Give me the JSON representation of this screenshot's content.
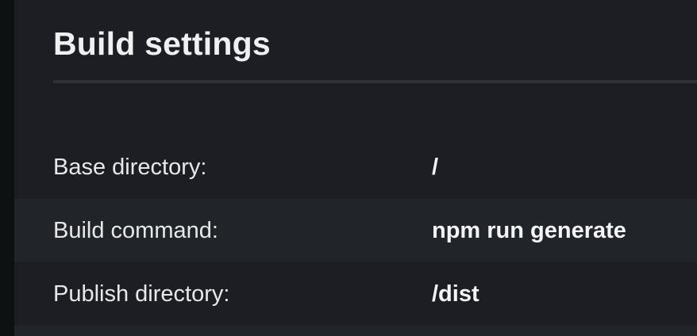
{
  "section": {
    "title": "Build settings"
  },
  "settings": [
    {
      "label": "Base directory:",
      "value": "/"
    },
    {
      "label": "Build command:",
      "value": "npm run generate"
    },
    {
      "label": "Publish directory:",
      "value": "/dist"
    }
  ],
  "colors": {
    "background": "#1c1e23",
    "row_alt_background": "#212429",
    "text": "#e6e8ea",
    "divider": "#2e3137"
  }
}
